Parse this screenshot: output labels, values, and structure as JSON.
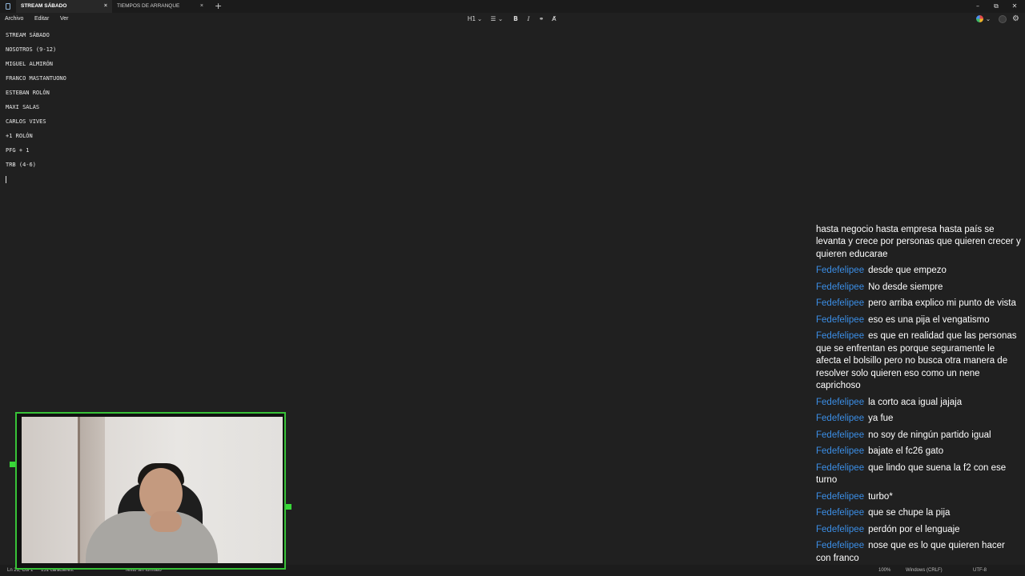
{
  "titlebar": {
    "tabs": [
      {
        "label": "STREAM SÁBADO",
        "active": true
      },
      {
        "label": "TIEMPOS DE ARRANQUE",
        "active": false
      }
    ],
    "close_glyph": "×",
    "new_tab_glyph": "+",
    "window_controls": {
      "minimize": "–",
      "maximize": "⧉",
      "close": "✕"
    }
  },
  "menu": {
    "items": [
      "Archivo",
      "Editar",
      "Ver"
    ]
  },
  "toolbar": {
    "heading": "H1",
    "heading_chevron": "⌄",
    "list_icon": "list-icon",
    "list_glyph": "☰",
    "list_chevron": "⌄",
    "bold": "B",
    "italic": "I",
    "link_glyph": "⚭",
    "clear_format_glyph": "A̸",
    "copilot_chevron": "⌄",
    "settings_glyph": "⚙"
  },
  "editor": {
    "lines": [
      "STREAM SÁBADO",
      "NOSOTROS (9-12)",
      "MIGUEL ALMIRÓN",
      "FRANCO MASTANTUONO",
      "ESTEBAN ROLÓN",
      "MAXI SALAS",
      "CARLOS VIVES",
      "+1 ROLÓN",
      "PFG + 1",
      "TRB (4-6)"
    ]
  },
  "statusbar": {
    "position": "Ln 21, Col 1",
    "char_count": "151 caracteres.",
    "format": "Texto sin formato",
    "zoom": "100%",
    "line_ending": "Windows (CRLF)",
    "encoding": "UTF-8"
  },
  "chat": {
    "partial_first": "hasta negocio hasta empresa hasta país se levanta y crece por personas que quieren crecer y quieren educarae",
    "messages": [
      {
        "user": "Fedefelipee",
        "text": "desde que empezo"
      },
      {
        "user": "Fedefelipee",
        "text": "No desde siempre"
      },
      {
        "user": "Fedefelipee",
        "text": "pero arriba explico mi punto de vista"
      },
      {
        "user": "Fedefelipee",
        "text": "eso es una pija el vengatismo"
      },
      {
        "user": "Fedefelipee",
        "text": "es que en realidad que las personas que se enfrentan es porque seguramente le afecta el bolsillo pero no busca otra manera de resolver solo quieren eso como un nene caprichoso"
      },
      {
        "user": "Fedefelipee",
        "text": "la corto aca igual jajaja"
      },
      {
        "user": "Fedefelipee",
        "text": "ya fue"
      },
      {
        "user": "Fedefelipee",
        "text": "no soy de ningún partido igual"
      },
      {
        "user": "Fedefelipee",
        "text": "bajate el fc26 gato"
      },
      {
        "user": "Fedefelipee",
        "text": "que lindo que suena la f2 con ese turno"
      },
      {
        "user": "Fedefelipee",
        "text": "turbo*"
      },
      {
        "user": "Fedefelipee",
        "text": "que se chupe la pija"
      },
      {
        "user": "Fedefelipee",
        "text": "perdón por el lenguaje"
      },
      {
        "user": "Fedefelipee",
        "text": "nose que es lo que quieren hacer con franco"
      }
    ]
  },
  "colors": {
    "background": "#202020",
    "chat_username": "#3b8ee6",
    "webcam_border": "#38c238"
  }
}
